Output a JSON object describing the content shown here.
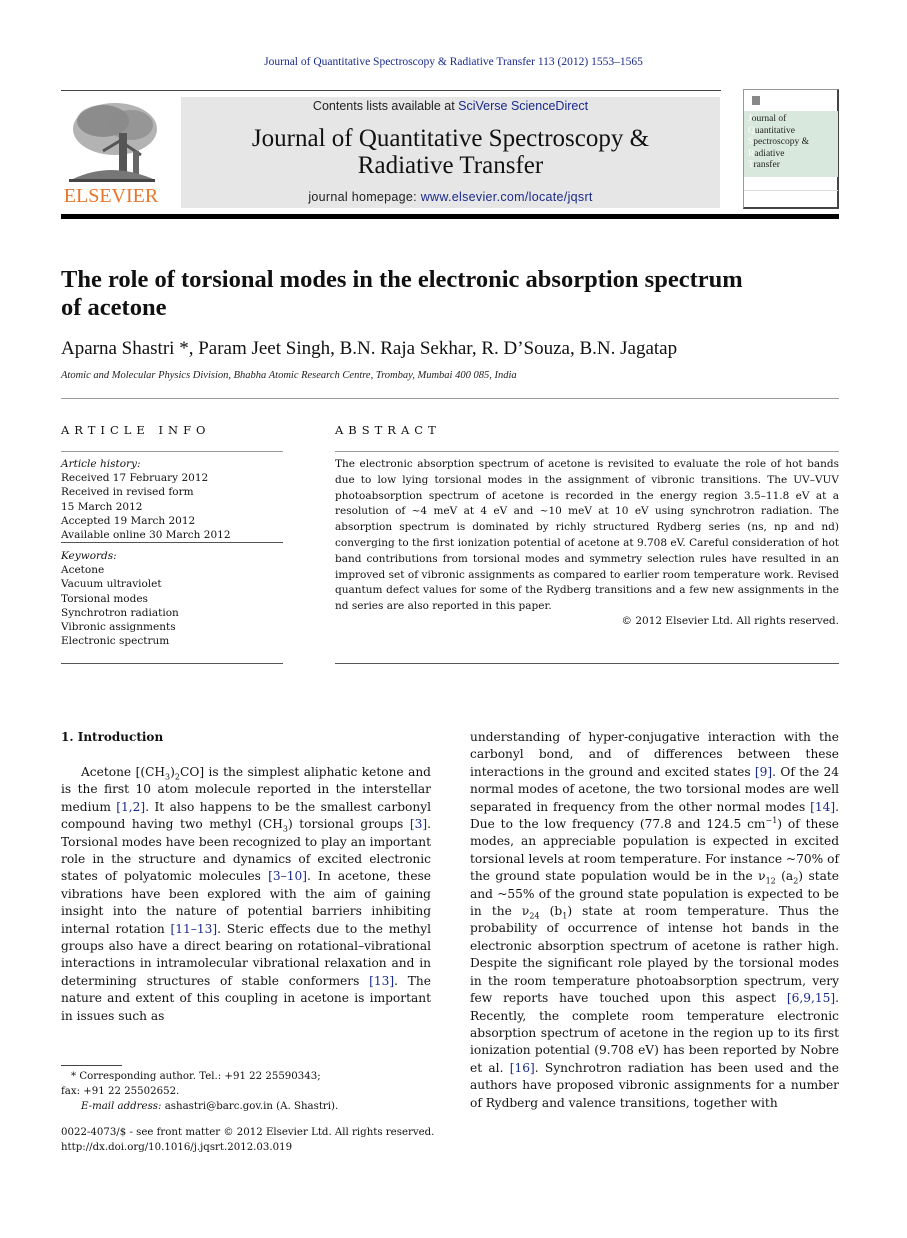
{
  "running_head": "Journal of Quantitative Spectroscopy & Radiative Transfer 113 (2012) 1553–1565",
  "masthead": {
    "publisher_logo_text": "ELSEVIER",
    "contents_prefix": "Contents lists available at ",
    "contents_link": "SciVerse ScienceDirect",
    "journal_title_line1": "Journal of Quantitative Spectroscopy &",
    "journal_title_line2": "Radiative Transfer",
    "homepage_prefix": "journal homepage: ",
    "homepage_link": "www.elsevier.com/locate/jqsrt",
    "cover_lines": [
      {
        "cap": "J",
        "rest": "ournal of"
      },
      {
        "cap": "Q",
        "rest": "uantitative"
      },
      {
        "cap": "S",
        "rest": "pectroscopy &"
      },
      {
        "cap": "R",
        "rest": "adiative"
      },
      {
        "cap": "T",
        "rest": "ransfer"
      }
    ]
  },
  "article": {
    "title_line1": "The role of torsional modes in the electronic absorption spectrum",
    "title_line2": "of acetone",
    "authors": "Aparna Shastri *, Param Jeet Singh, B.N. Raja Sekhar, R. D’Souza, B.N. Jagatap",
    "affiliation": "Atomic and Molecular Physics Division, Bhabha Atomic Research Centre, Trombay, Mumbai 400 085, India"
  },
  "article_info": {
    "heading": "ARTICLE INFO",
    "history_label": "Article history:",
    "history": [
      "Received 17 February 2012",
      "Received in revised form",
      "15 March 2012",
      "Accepted 19 March 2012",
      "Available online 30 March 2012"
    ],
    "keywords_label": "Keywords:",
    "keywords": [
      "Acetone",
      "Vacuum ultraviolet",
      "Torsional modes",
      "Synchrotron radiation",
      "Vibronic assignments",
      "Electronic spectrum"
    ]
  },
  "abstract": {
    "heading": "ABSTRACT",
    "text": "The electronic absorption spectrum of acetone is revisited to evaluate the role of hot bands due to low lying torsional modes in the assignment of vibronic transitions. The UV–VUV photoabsorption spectrum of acetone is recorded in the energy region 3.5–11.8 eV at a resolution of ~4 meV at 4 eV and ~10 meV at 10 eV using synchrotron radiation. The absorption spectrum is dominated by richly structured Rydberg series (ns, np and nd) converging to the first ionization potential of acetone at 9.708 eV. Careful consideration of hot band contributions from torsional modes and symmetry selection rules have resulted in an improved set of vibronic assignments as compared to earlier room temperature work. Revised quantum defect values for some of the Rydberg transitions and a few new assignments in the nd series are also reported in this paper.",
    "copyright": "© 2012 Elsevier Ltd. All rights reserved."
  },
  "introduction": {
    "heading": "1.  Introduction",
    "left": {
      "p1": "Acetone [(CH",
      "p1_sub1": "3",
      "p1_b": ")",
      "p1_sub2": "2",
      "p1_c": "CO] is the simplest aliphatic ketone and is the first 10 atom molecule reported in the interstellar medium ",
      "ref1": "[1,2]",
      "p1_d": ". It also happens to be the smallest carbonyl compound having two methyl (CH",
      "p1_sub3": "3",
      "p1_e": ") torsional groups ",
      "ref2": "[3]",
      "p1_f": ". Torsional modes have been recognized to play an important role in the structure and dynamics of excited electronic states of polyatomic molecules ",
      "ref3": "[3–10]",
      "p1_g": ". In acetone, these vibrations have been explored with the aim of gaining insight into the nature of potential barriers inhibiting internal rotation ",
      "ref4": "[11–13]",
      "p1_h": ". Steric effects due to the methyl groups also have a direct bearing on rotational–vibrational interactions in intramolecular vibrational relaxation and in determining structures of stable conformers ",
      "ref5": "[13]",
      "p1_i": ". The nature and extent of this coupling in acetone is important in issues such as"
    },
    "right": {
      "a": "understanding of hyper-conjugative interaction with the carbonyl bond, and of differences between these interactions in the ground and excited states ",
      "ref1": "[9]",
      "b": ". Of the 24 normal modes of acetone, the two torsional modes are well separated in frequency from the other normal modes ",
      "ref2": "[14]",
      "c": ". Due to the low frequency (77.8 and 124.5 cm",
      "c_sup": "−1",
      "d": ") of these modes, an appreciable population is expected in excited torsional levels at room temperature. For instance ~70% of the ground state population would be in the ν",
      "d_sub": "12",
      "e": " (a",
      "e_sub": "2",
      "f": ") state and ~55% of the ground state population is expected to be in the ν",
      "f_sub": "24",
      "g": " (b",
      "g_sub": "1",
      "h": ") state at room temperature. Thus the probability of occurrence of intense hot bands in the electronic absorption spectrum of acetone is rather high. Despite the significant role played by the torsional modes in the room temperature photoabsorption spectrum, very few reports have touched upon this aspect ",
      "ref3": "[6,9,15]",
      "i": ". Recently, the complete room temperature electronic absorption spectrum of acetone in the region up to its first ionization potential (9.708 eV) has been reported by Nobre et al. ",
      "ref4": "[16]",
      "j": ". Synchrotron radiation has been used and the authors have proposed vibronic assignments for a number of Rydberg and valence transitions, together with"
    }
  },
  "footnote": {
    "corresponding": "* Corresponding author. Tel.: +91 22 25590343;",
    "fax": "fax: +91 22 25502652.",
    "email_label": "E-mail address:",
    "email": " ashastri@barc.gov.in (A. Shastri)."
  },
  "front_matter": {
    "issn_line": "0022-4073/$ - see front matter © 2012 Elsevier Ltd. All rights reserved.",
    "doi": "http://dx.doi.org/10.1016/j.jqsrt.2012.03.019"
  }
}
